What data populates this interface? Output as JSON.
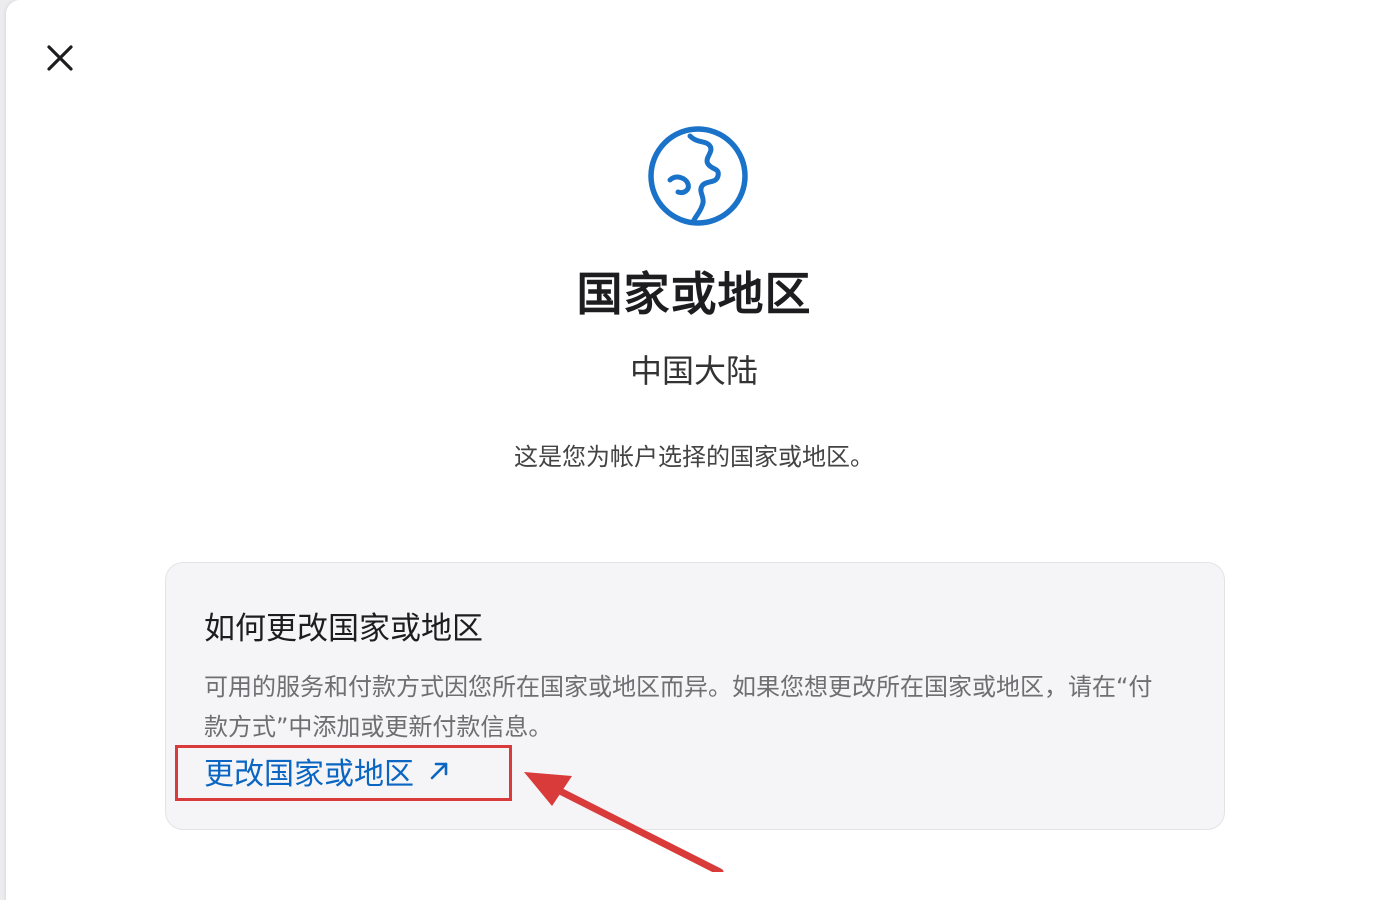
{
  "dialog": {
    "title": "国家或地区",
    "country": "中国大陆",
    "description": "这是您为帐户选择的国家或地区。",
    "close_icon": "close-icon",
    "globe_icon": "globe-icon"
  },
  "help_card": {
    "title": "如何更改国家或地区",
    "body": "可用的服务和付款方式因您所在国家或地区而异。如果您想更改所在国家或地区，请在“付款方式”中添加或更新付款信息。",
    "link_label": "更改国家或地区",
    "link_icon": "external-arrow-icon"
  },
  "colors": {
    "accent": "#0a66c2",
    "globe": "#1a73c8",
    "annotation": "#d93a3a"
  }
}
